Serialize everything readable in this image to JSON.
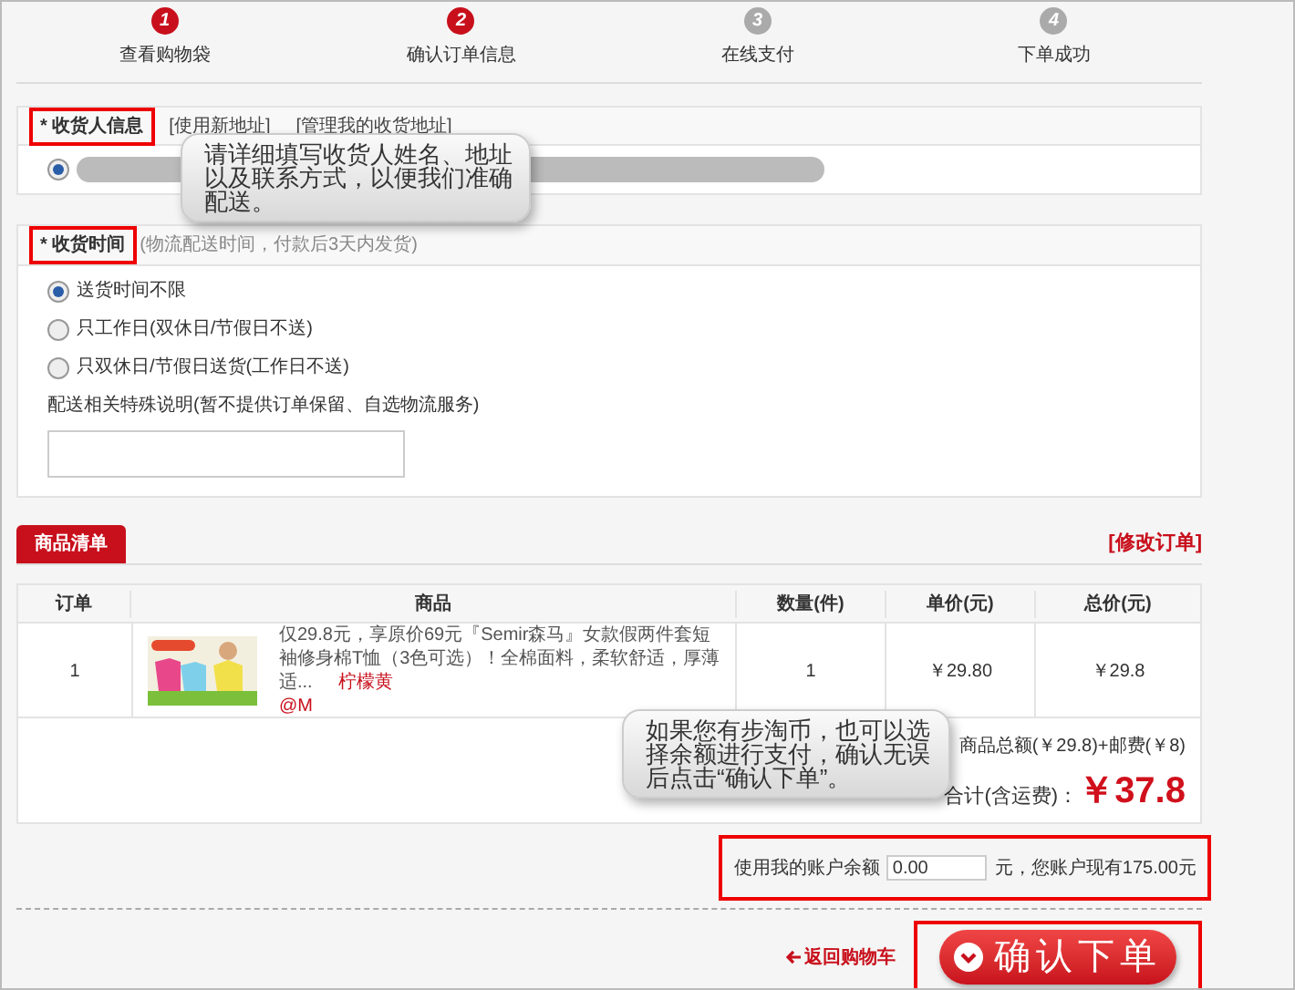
{
  "steps": [
    {
      "number": "1",
      "label": "查看购物袋",
      "done": true
    },
    {
      "number": "2",
      "label": "确认订单信息",
      "done": true
    },
    {
      "number": "3",
      "label": "在线支付",
      "done": false
    },
    {
      "number": "4",
      "label": "下单成功",
      "done": false
    }
  ],
  "address": {
    "title": "* 收货人信息",
    "highlighted": true,
    "links": [
      "[使用新地址]",
      "[管理我的收货地址]"
    ],
    "options": [
      {
        "selected": true
      }
    ]
  },
  "delivery": {
    "title": "* 收货时间",
    "highlighted": true,
    "hint": "(物流配送时间，付款后3天内发货)",
    "options": [
      {
        "label": "送货时间不限",
        "selected": true
      },
      {
        "label": "只工作日(双休日/节假日不送)",
        "selected": false
      },
      {
        "label": "只双休日/节假日送货(工作日不送)",
        "selected": false
      }
    ],
    "note_label": "配送相关特殊说明(暂不提供订单保留、自选物流服务)"
  },
  "products": {
    "tab": "商品清单",
    "edit_link": "[修改订单]",
    "columns": [
      "订单",
      "商品",
      "数量(件)",
      "单价(元)",
      "总价(元)"
    ],
    "rows": [
      {
        "order": "1",
        "description": "仅29.8元，享原价69元『Semir森马』女款假两件套短袖修身棉T恤（3色可选）！全棉面料，柔软舒适，厚薄适...",
        "color_name": "柠檬黄",
        "suffix": "@M",
        "quantity": "1",
        "unit_price": "￥29.80",
        "total": "￥29.8"
      }
    ],
    "subtotal": "商品总额(￥29.8)+邮费(￥8)",
    "total_label": "合计(含运费)：",
    "total": "￥37.8"
  },
  "balance": {
    "highlighted": true,
    "label": "使用我的账户余额",
    "value": "0.00",
    "note": "元，您账户现有175.00元"
  },
  "actions": {
    "back": "返回购物车",
    "confirm": "确认下单",
    "highlighted": true
  },
  "callouts": [
    {
      "text": "请详细填写收货人姓名、地址以及联系方式，以便我们准确配送。"
    },
    {
      "text": "如果您有步淘币，也可以选择余额进行支付，确认无误后点击“确认下单”。"
    }
  ]
}
